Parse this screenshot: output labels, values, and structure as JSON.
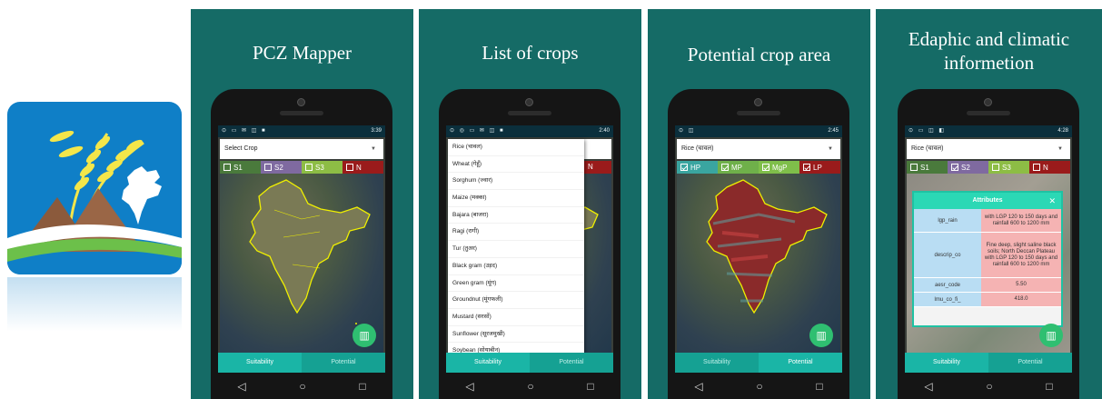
{
  "colors": {
    "panel_bg": "#156b66",
    "tab_active": "#1ab5a6",
    "fab": "#2fbf71"
  },
  "panels": [
    {
      "title": "PCZ Mapper",
      "status_time": "3:39",
      "select_value": "Select Crop",
      "legend": [
        {
          "label": "S1",
          "checked": false
        },
        {
          "label": "S2",
          "checked": false
        },
        {
          "label": "S3",
          "checked": false
        },
        {
          "label": "N",
          "checked": false
        }
      ],
      "tabs": [
        "Suitability",
        "Potential"
      ],
      "active_tab": 0
    },
    {
      "title": "List of crops",
      "status_time": "2:40",
      "legend_visible": "N",
      "crops": [
        "Rice (चावल)",
        "Wheat (गेहूँ)",
        "Sorghum (ज्वार)",
        "Maize (मक्का)",
        "Bajara (बाजरा)",
        "Ragi (रागी)",
        "Tur (तुअर)",
        "Black gram (उड़द)",
        "Green gram (मूंग)",
        "Groundnut (मूंगफली)",
        "Mustard (सरसों)",
        "Sunflower (सूरजमुखी)",
        "Soybean (सोयाबीन)"
      ],
      "tabs": [
        "Suitability",
        "Potential"
      ],
      "active_tab": 0
    },
    {
      "title": "Potential crop area",
      "status_time": "2:45",
      "select_value": "Rice (चावल)",
      "legend": [
        {
          "label": "HP",
          "checked": true
        },
        {
          "label": "MP",
          "checked": true
        },
        {
          "label": "MgP",
          "checked": true
        },
        {
          "label": "LP",
          "checked": true
        }
      ],
      "tabs": [
        "Suitability",
        "Potential"
      ],
      "active_tab": 1
    },
    {
      "title": "Edaphic and climatic informetion",
      "status_time": "4:28",
      "select_value": "Rice (चावल)",
      "legend": [
        {
          "label": "S1",
          "checked": false
        },
        {
          "label": "S2",
          "checked": true
        },
        {
          "label": "S3",
          "checked": false
        },
        {
          "label": "N",
          "checked": false
        }
      ],
      "attributes": {
        "title": "Attributes",
        "close": "✕",
        "rows": [
          {
            "key": "lgp_rain",
            "value": "with LGP 120 to 150 days and rainfall 600 to 1200 mm"
          },
          {
            "key": "descrip_co",
            "value": "Fine deep, slight saline black soils; North Deccan Plateau with LGP 120 to 150 days and rainfall 600 to 1200 mm"
          },
          {
            "key": "aesr_code",
            "value": "5.50"
          },
          {
            "key": "lmu_co_fi_",
            "value": "418.0"
          }
        ]
      },
      "tabs": [
        "Suitability",
        "Potential"
      ],
      "active_tab": 0
    }
  ],
  "icons": {
    "nav_back": "◁",
    "nav_home": "○",
    "nav_recent": "□",
    "fab": "map-icon"
  }
}
